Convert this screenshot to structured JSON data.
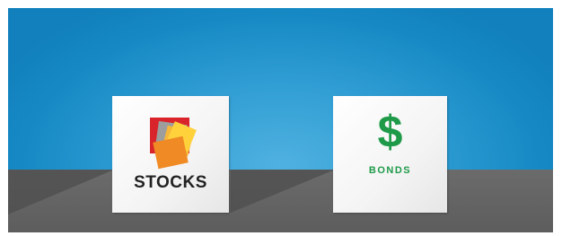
{
  "stocks_card": {
    "label": "STOCKS",
    "icon": "stacked-colored-squares-icon",
    "label_color": "#222222"
  },
  "bonds_card": {
    "symbol": "$",
    "label": "BONDS",
    "icon": "dollar-sign-icon",
    "accent": "#1e9a48"
  },
  "colors": {
    "wall": "#2f9dd3",
    "floor": "#666666",
    "card": "#ffffff"
  }
}
